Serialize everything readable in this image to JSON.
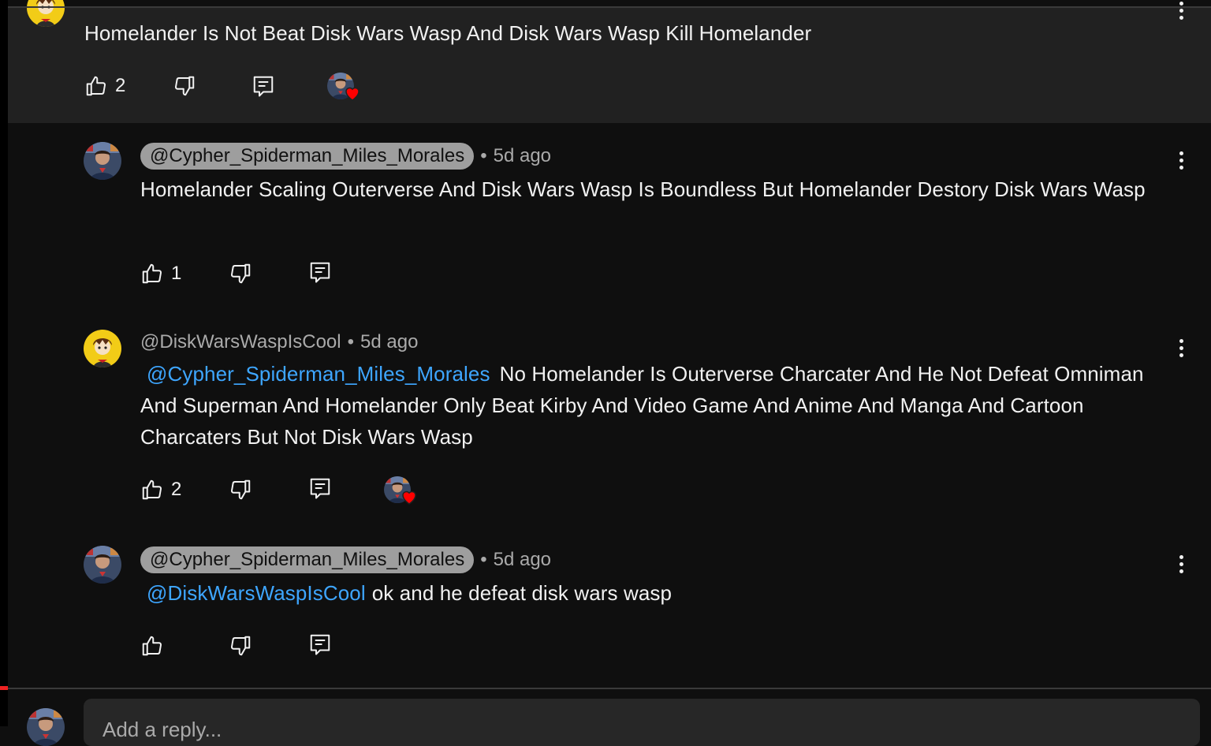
{
  "parent_comment": {
    "text": "Homelander Is Not Beat Disk Wars Wasp And Disk Wars Wasp Kill Homelander",
    "likes": "2"
  },
  "replies": [
    {
      "handle": "@Cypher_Spiderman_Miles_Morales",
      "handle_style": "pill",
      "time": "5d ago",
      "text": "Homelander Scaling Outerverse And Disk Wars Wasp Is Boundless But Homelander Destory Disk Wars Wasp",
      "likes": "1",
      "hearted": false
    },
    {
      "handle": "@DiskWarsWaspIsCool",
      "handle_style": "plain",
      "time": "5d ago",
      "mention": "@Cypher_Spiderman_Miles_Morales",
      "text": "No Homelander Is Outerverse Charcater And He Not Defeat Omniman And Superman And Homelander Only Beat Kirby And Video Game And Anime And Manga And Cartoon Charcaters But Not Disk Wars Wasp",
      "likes": "2",
      "hearted": true
    },
    {
      "handle": "@Cypher_Spiderman_Miles_Morales",
      "handle_style": "pill",
      "time": "5d ago",
      "mention": "@DiskWarsWaspIsCool",
      "text": "ok and he defeat disk wars wasp",
      "likes": "",
      "hearted": false
    }
  ],
  "separator": "•",
  "reply_box": {
    "placeholder": "Add a reply..."
  },
  "icons": [
    "like-icon",
    "dislike-icon",
    "reply-icon",
    "more-icon",
    "creator-heart-icon"
  ],
  "colors": {
    "background": "#0f0f0f",
    "highlight": "#212121",
    "mention": "#3ea6ff",
    "heart": "#ff0000",
    "pill": "#9e9e9e"
  }
}
